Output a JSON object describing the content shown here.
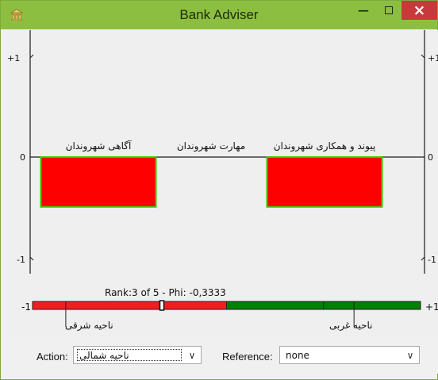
{
  "window": {
    "title": "Bank Adviser",
    "minimize_label": "−",
    "maximize_label": "",
    "close_label": "×",
    "icon": "bank-icon"
  },
  "colors": {
    "titlebar": "#8cbf3f",
    "close": "#c8393b",
    "bar_fill": "#ff0000",
    "bar_border": "#39c900",
    "red_segment": "#ef1f1f",
    "green_segment": "#008000"
  },
  "axes": {
    "left_top_label": "+1",
    "left_zero_label": "0",
    "left_bottom_label": "-1",
    "right_top_label": "+1",
    "right_zero_label": "0",
    "right_bottom_label": "-1"
  },
  "chart_data": {
    "type": "bar",
    "categories": [
      "آگاهی شهروندان",
      "مهارت شهروندان",
      "پیوند و همکاری شهروندان"
    ],
    "values": [
      -0.5,
      0,
      -0.5
    ],
    "ylim": [
      -1,
      1
    ],
    "grid": false
  },
  "scale": {
    "rank_text": "Rank:3 of 5 - Phi: -0,3333",
    "left_label": "-1",
    "right_label": "+1",
    "phi": -0.3333,
    "red_end": 0,
    "marker_value": -0.3333,
    "tick_values": [
      -0.8286,
      0.5,
      0.6571
    ],
    "left_annotation": "ناحیه شرقی",
    "right_annotation": "ناحیه غربی"
  },
  "controls": {
    "action_label": "Action:",
    "action_value": "ناحیه شمالی",
    "reference_label": "Reference:",
    "reference_value": "none",
    "dropdown_icon": "chevron-down-icon"
  }
}
